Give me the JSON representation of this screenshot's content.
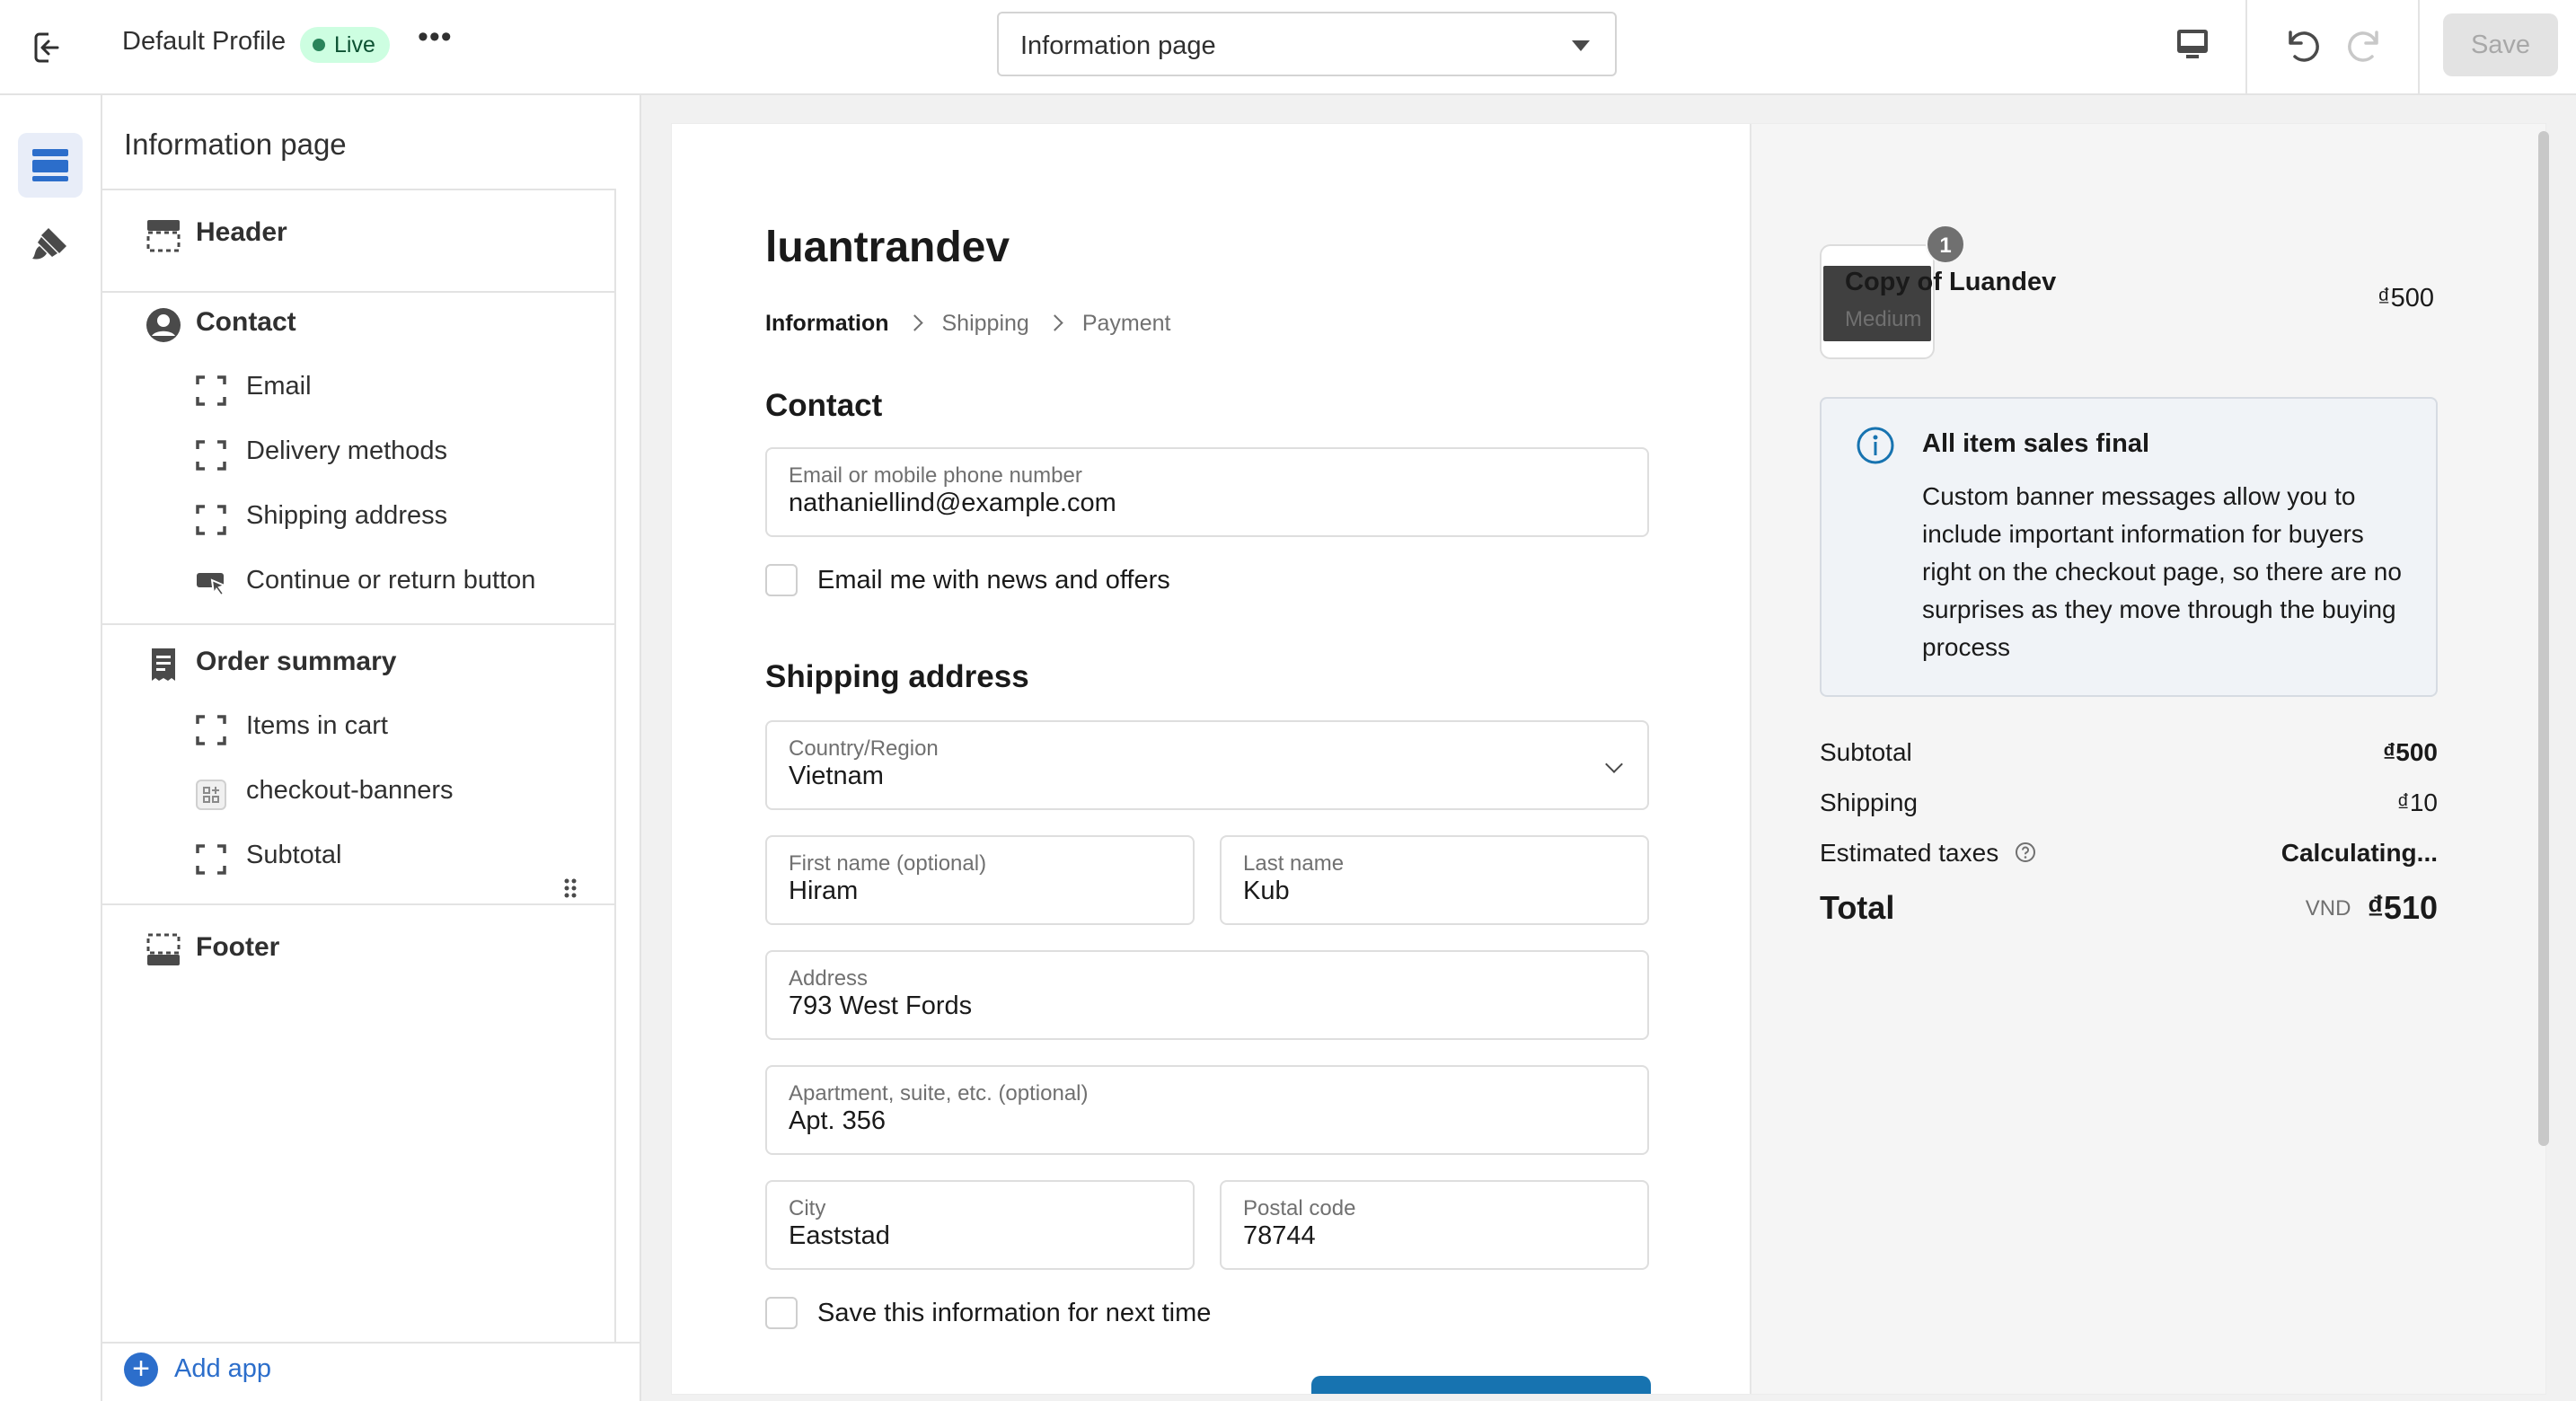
{
  "topbar": {
    "profile_name": "Default Profile",
    "status_badge": "Live",
    "more_label": "•••",
    "page_select": "Information page",
    "save_label": "Save"
  },
  "panel": {
    "title": "Information page",
    "sections": [
      {
        "label": "Header",
        "icon": "header-layout-icon"
      },
      {
        "label": "Contact",
        "icon": "person-icon",
        "items": [
          {
            "label": "Email",
            "icon": "block-icon"
          },
          {
            "label": "Delivery methods",
            "icon": "block-icon"
          },
          {
            "label": "Shipping address",
            "icon": "block-icon"
          },
          {
            "label": "Continue or return button",
            "icon": "button-cursor-icon"
          }
        ]
      },
      {
        "label": "Order summary",
        "icon": "receipt-icon",
        "items": [
          {
            "label": "Items in cart",
            "icon": "block-icon"
          },
          {
            "label": "checkout-banners",
            "icon": "app-block-icon"
          },
          {
            "label": "Subtotal",
            "icon": "block-icon"
          }
        ]
      },
      {
        "label": "Footer",
        "icon": "footer-layout-icon"
      }
    ],
    "add_app": "Add app"
  },
  "checkout": {
    "shop_name": "luantrandev",
    "breadcrumbs": [
      "Information",
      "Shipping",
      "Payment"
    ],
    "contact_heading": "Contact",
    "email_label": "Email or mobile phone number",
    "email_value": "nathaniellind@example.com",
    "news_label": "Email me with news and offers",
    "shipping_heading": "Shipping address",
    "country_label": "Country/Region",
    "country_value": "Vietnam",
    "first_label": "First name (optional)",
    "first_value": "Hiram",
    "last_label": "Last name",
    "last_value": "Kub",
    "address_label": "Address",
    "address_value": "793 West Fords",
    "apt_label": "Apartment, suite, etc. (optional)",
    "apt_value": "Apt. 356",
    "city_label": "City",
    "city_value": "Eaststad",
    "postal_label": "Postal code",
    "postal_value": "78744",
    "save_info_label": "Save this information for next time"
  },
  "summary": {
    "item_qty": "1",
    "item_name": "Copy of Luandev",
    "item_variant": "Medium",
    "item_price": "₫500",
    "banner_title": "All item sales final",
    "banner_body": "Custom banner messages allow you to include important information for buyers right on the checkout page, so there are no surprises as they move through the buying process",
    "subtotal_label": "Subtotal",
    "subtotal_value": "₫500",
    "shipping_label": "Shipping",
    "shipping_value": "₫10",
    "taxes_label": "Estimated taxes",
    "taxes_value": "Calculating...",
    "total_label": "Total",
    "total_currency": "VND",
    "total_value": "₫510"
  },
  "colors": {
    "accent": "#2c6ecb",
    "live_bg": "#cdfee1",
    "cta": "#1773b0"
  }
}
